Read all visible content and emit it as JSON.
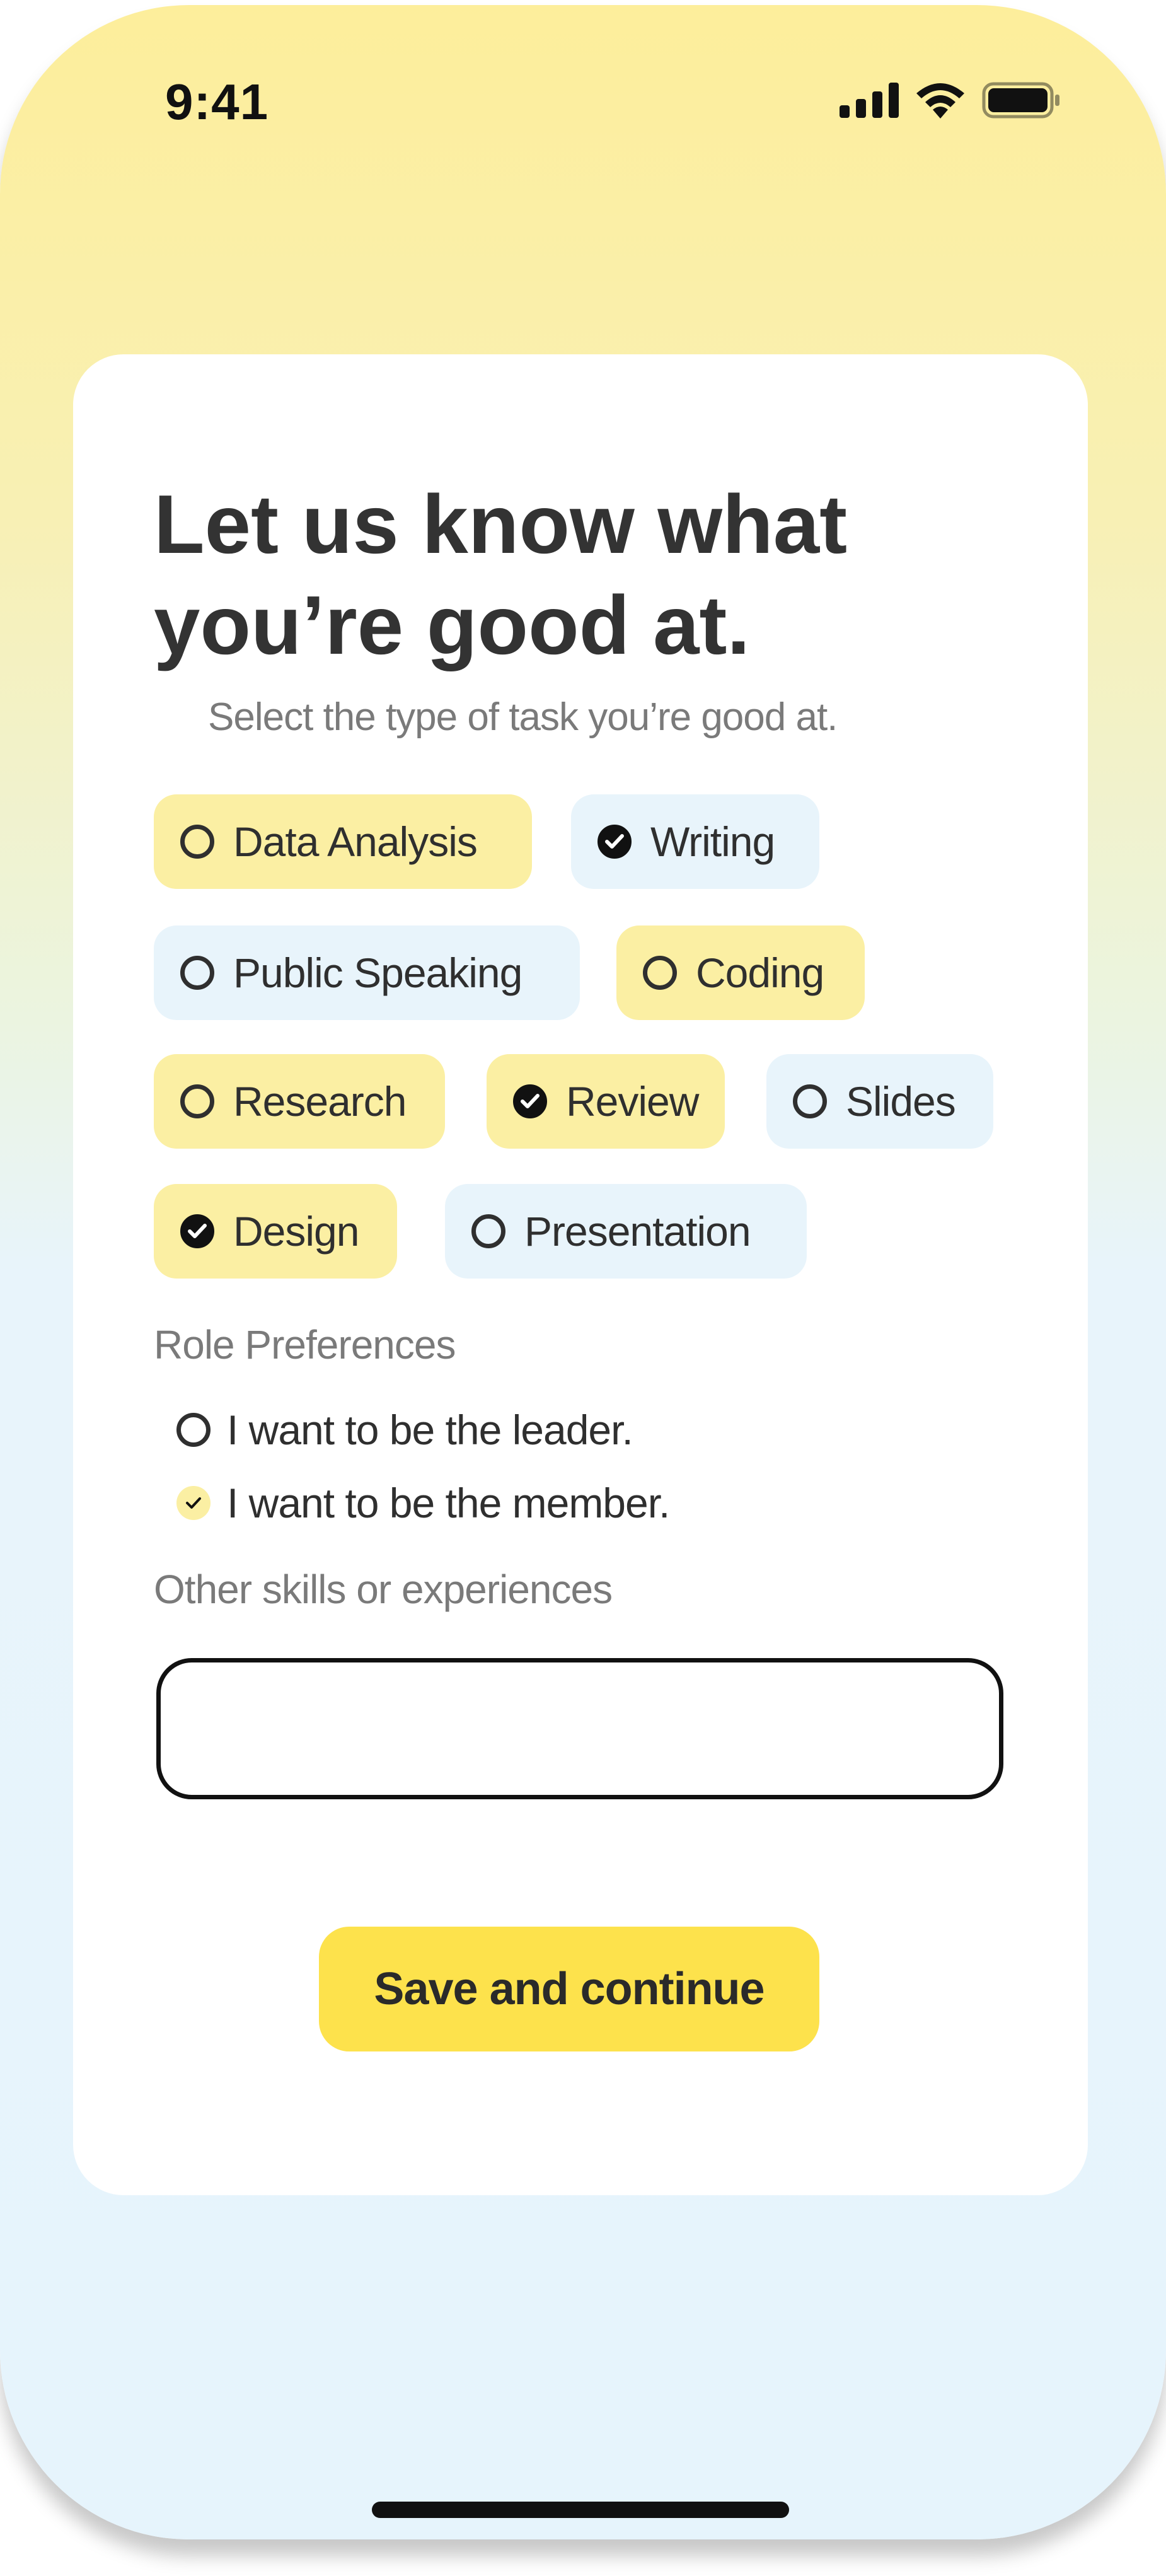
{
  "status_bar": {
    "time": "9:41",
    "icons": [
      "cellular-signal-icon",
      "wifi-icon",
      "battery-icon"
    ]
  },
  "form": {
    "title": "Let us know what\nyou’re good at.",
    "subtitle": "Select the type of task you’re good at.",
    "tasks": [
      {
        "label": "Data Analysis",
        "checked": false,
        "color": "yellow"
      },
      {
        "label": "Writing",
        "checked": true,
        "color": "blue"
      },
      {
        "label": "Public Speaking",
        "checked": false,
        "color": "blue"
      },
      {
        "label": "Coding",
        "checked": false,
        "color": "yellow"
      },
      {
        "label": "Research",
        "checked": false,
        "color": "yellow"
      },
      {
        "label": "Review",
        "checked": true,
        "color": "yellow"
      },
      {
        "label": "Slides",
        "checked": false,
        "color": "blue"
      },
      {
        "label": "Design",
        "checked": true,
        "color": "yellow"
      },
      {
        "label": "Presentation",
        "checked": false,
        "color": "blue"
      }
    ],
    "role_label": "Role Preferences",
    "roles": [
      {
        "label": "I want to be the leader.",
        "checked": false
      },
      {
        "label": "I want to be the member.",
        "checked": true
      }
    ],
    "skills_label": "Other skills or experiences",
    "skills_value": "",
    "save_label": "Save and continue"
  },
  "colors": {
    "chip_yellow": "#fbefa3",
    "chip_blue": "#e8f4fb",
    "button": "#fde24c",
    "text": "#333333",
    "muted": "#7a7a7a"
  }
}
